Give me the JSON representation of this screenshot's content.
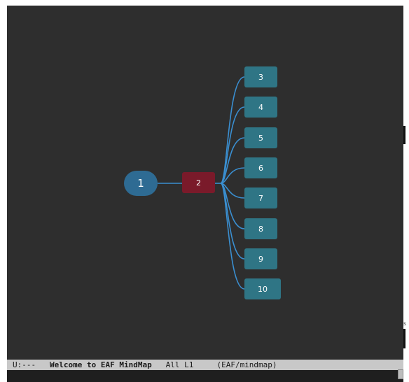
{
  "mindmap": {
    "root": {
      "label": "1"
    },
    "child": {
      "label": "2"
    },
    "leaves": [
      {
        "label": "3"
      },
      {
        "label": "4"
      },
      {
        "label": "5"
      },
      {
        "label": "6"
      },
      {
        "label": "7"
      },
      {
        "label": "8"
      },
      {
        "label": "9"
      },
      {
        "label": "10"
      }
    ],
    "colors": {
      "background": "#2e2e2e",
      "root": "#2e6b93",
      "child": "#7a1a2a",
      "leaf": "#2f7585",
      "edge": "#3a8fd1"
    }
  },
  "modeline": {
    "status": "U:---",
    "buffer_name": "Welcome to EAF MindMap",
    "position": "All L1",
    "mode": "(EAF/mindmap)"
  },
  "gutter": {
    "text": "s"
  }
}
